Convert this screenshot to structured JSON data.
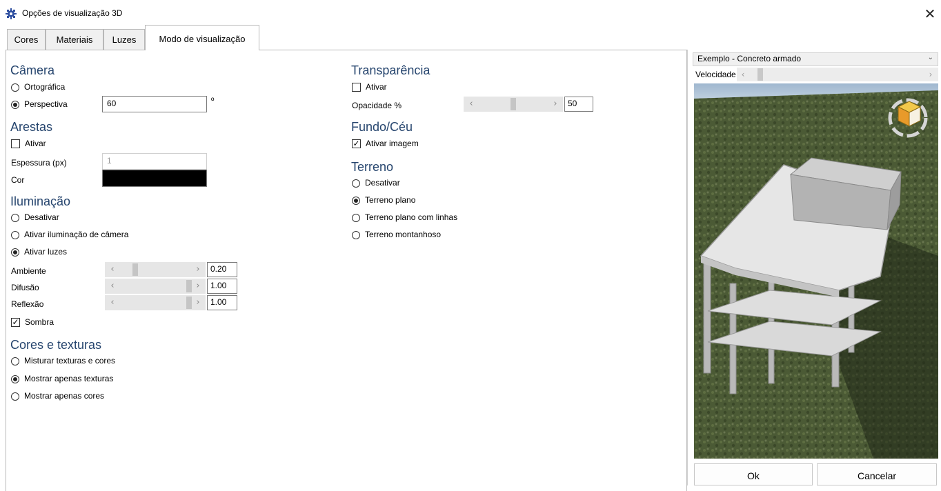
{
  "window": {
    "title": "Opções de visualização 3D",
    "close_glyph": "✕",
    "app_icon": "gear-icon"
  },
  "tabs": [
    {
      "label": "Cores"
    },
    {
      "label": "Materiais"
    },
    {
      "label": "Luzes"
    },
    {
      "label": "Modo de visualização",
      "active": true
    }
  ],
  "camera": {
    "heading": "Câmera",
    "ortho_label": "Ortográfica",
    "persp_label": "Perspectiva",
    "fov_value": "60",
    "degree": "º",
    "selected": "perspectiva"
  },
  "edges": {
    "heading": "Arestas",
    "enable_label": "Ativar",
    "enabled": false,
    "thickness_label": "Espessura (px)",
    "thickness_value": "1",
    "color_label": "Cor",
    "color": "#000000"
  },
  "lighting": {
    "heading": "Iluminação",
    "options": [
      "Desativar",
      "Ativar iluminação de câmera",
      "Ativar luzes"
    ],
    "selected_index": 2,
    "ambient_label": "Ambiente",
    "ambient_value": "0.20",
    "ambient_level": 0.2,
    "diffuse_label": "Difusão",
    "diffuse_value": "1.00",
    "diffuse_level": 1.0,
    "reflection_label": "Reflexão",
    "reflection_value": "1.00",
    "reflection_level": 1.0,
    "shadow_label": "Sombra",
    "shadow_checked": true
  },
  "textures": {
    "heading": "Cores e texturas",
    "options": [
      "Misturar texturas e cores",
      "Mostrar apenas texturas",
      "Mostrar apenas cores"
    ],
    "selected_index": 1
  },
  "transparency": {
    "heading": "Transparência",
    "enable_label": "Ativar",
    "enabled": false,
    "opacity_label": "Opacidade %",
    "opacity_value": "50",
    "opacity_level": 0.5
  },
  "background": {
    "heading": "Fundo/Céu",
    "image_label": "Ativar imagem",
    "image_checked": true
  },
  "terrain": {
    "heading": "Terreno",
    "options": [
      "Desativar",
      "Terreno plano",
      "Terreno plano com linhas",
      "Terreno montanhoso"
    ],
    "selected_index": 1
  },
  "preview": {
    "example_value": "Exemplo - Concreto armado",
    "speed_label": "Velocidade",
    "grass_color": "#4a5b33",
    "sky_color": "#b4c8dc",
    "structure_color": "#d8d8d8"
  },
  "buttons": {
    "ok": "Ok",
    "cancel": "Cancelar"
  },
  "glyphs": {
    "left": "‹",
    "right": "›",
    "check": "✓",
    "chevron": "⌄"
  }
}
